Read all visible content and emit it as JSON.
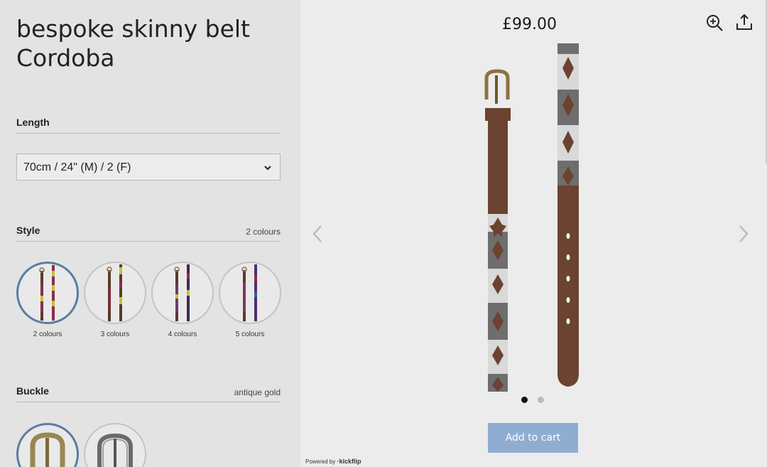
{
  "product": {
    "title_line1": "bespoke skinny belt",
    "title_line2": "Cordoba",
    "price": "£99.00"
  },
  "length": {
    "label": "Length",
    "selected": "70cm / 24\" (M) / 2 (F)"
  },
  "style": {
    "label": "Style",
    "selected": "2 colours",
    "options": [
      {
        "label": "2 colours"
      },
      {
        "label": "3 colours"
      },
      {
        "label": "4 colours"
      },
      {
        "label": "5 colours"
      }
    ]
  },
  "buckle": {
    "label": "Buckle",
    "selected": "antique gold",
    "options": [
      "antique gold",
      "silver"
    ]
  },
  "actions": {
    "add_to_cart": "Add to cart"
  },
  "footer": {
    "powered_prefix": "Powered by",
    "powered_brand": "·kickflip"
  },
  "gallery": {
    "current_index": 1,
    "total": 2
  },
  "colors": {
    "accent": "#8fadd0",
    "selected_ring": "#5b7da0",
    "leather": "#6b4330"
  },
  "icons": [
    "zoom-in-icon",
    "share-icon",
    "chevron-down-icon",
    "chevron-left-icon",
    "chevron-right-icon"
  ]
}
